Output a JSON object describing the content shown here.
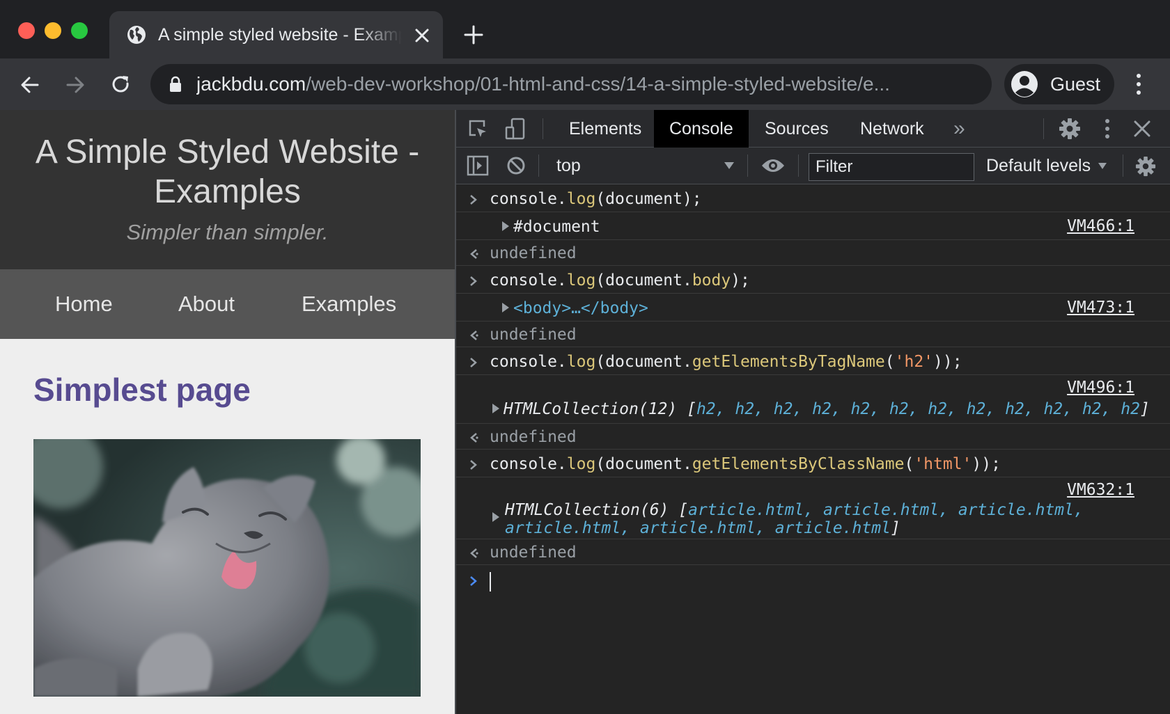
{
  "browser": {
    "tab_title": "A simple styled website - Examples",
    "url_host": "jackbdu.com",
    "url_path": "/web-dev-workshop/01-html-and-css/14-a-simple-styled-website/e...",
    "profile_label": "Guest"
  },
  "site": {
    "title": "A Simple Styled Website - Examples",
    "tagline": "Simpler than simpler.",
    "nav": [
      "Home",
      "About",
      "Examples"
    ],
    "article_title": "Simplest page",
    "photo_icon": "cat-photo"
  },
  "devtools": {
    "tabs": [
      "Elements",
      "Console",
      "Sources",
      "Network"
    ],
    "more_tabs": "»",
    "active_tab": "Console",
    "context": "top",
    "filter_placeholder": "Filter",
    "levels": "Default levels",
    "console": {
      "l1": {
        "a": "console.",
        "b": "log",
        "c": "(document);",
        "out": "#document",
        "vm": "VM466:1",
        "ret": "undefined"
      },
      "l2": {
        "a": "console.",
        "b": "log",
        "c": "(document.",
        "d": "body",
        "e": ");",
        "out": "<body>…</body>",
        "vm": "VM473:1",
        "ret": "undefined"
      },
      "l3": {
        "a": "console.",
        "b": "log",
        "c": "(document.",
        "d": "getElementsByTagName",
        "e": "(",
        "f": "'h2'",
        "g": "));",
        "out_a": "HTMLCollection(12) [",
        "out_b": "h2, h2, h2, h2, h2, h2, h2, h2, h2, h2, h2, h2",
        "out_c": "]",
        "vm": "VM496:1",
        "ret": "undefined"
      },
      "l4": {
        "a": "console.",
        "b": "log",
        "c": "(document.",
        "d": "getElementsByClassName",
        "e": "(",
        "f": "'html'",
        "g": "));",
        "out_a": "HTMLCollection(6) [",
        "out_b": "article.html, article.html, article.html,",
        "out_c": "article.html, article.html, article.html",
        "out_d": "]",
        "vm": "VM632:1",
        "ret": "undefined"
      }
    }
  },
  "colors": {
    "accent_purple": "#574b90",
    "console_function": "#dbc77a",
    "console_string": "#f29766",
    "console_element": "#5db0d7"
  }
}
